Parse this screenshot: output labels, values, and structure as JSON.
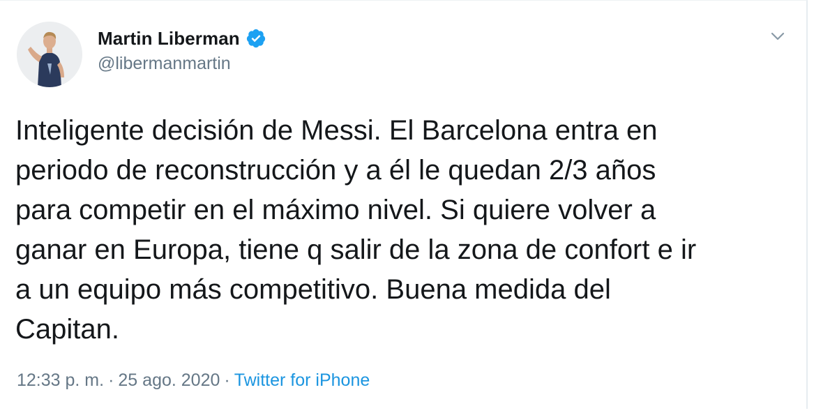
{
  "author": {
    "display_name": "Martin Liberman",
    "handle": "@libermanmartin",
    "verified": true
  },
  "tweet": {
    "text": "Inteligente decisión de Messi. El Barcelona entra en\nperiodo de reconstrucción y a él le quedan 2/3 años\npara competir en el máximo nivel. Si quiere volver a\nganar en Europa, tiene q salir de la zona de confort e ir\na un equipo más competitivo. Buena medida del\nCapitan."
  },
  "meta": {
    "time": "12:33 p. m.",
    "separator_1": "·",
    "date": "25 ago. 2020",
    "separator_2": "·",
    "source": "Twitter for iPhone"
  },
  "icons": {
    "verified": "verified-badge-icon",
    "menu": "chevron-down-icon"
  },
  "colors": {
    "text_primary": "#14171a",
    "text_secondary": "#657786",
    "link": "#1b95e0",
    "verified": "#1da1f2"
  }
}
